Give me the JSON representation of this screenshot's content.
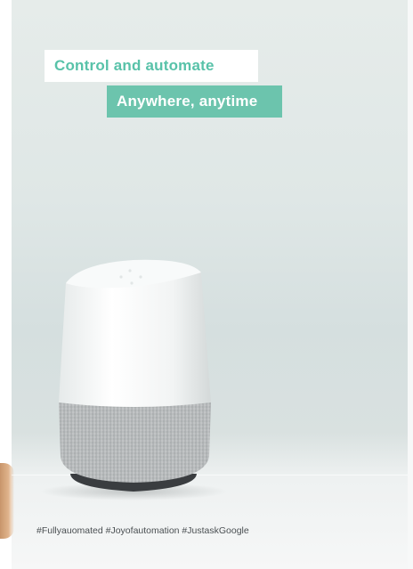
{
  "headline": {
    "line1": "Control and automate",
    "line2": "Anywhere, anytime"
  },
  "hashtags": "#Fullyauomated #Joyofautomation #JustaskGoogle",
  "colors": {
    "accent_teal": "#6cc4ad",
    "headline_text": "#58c2a9",
    "background": "#dfe7e6",
    "speaker_top": "#f4f6f6",
    "speaker_fabric": "#b9bcbd",
    "speaker_base": "#3c3f42"
  },
  "product": {
    "icon": "smart-speaker-icon"
  }
}
